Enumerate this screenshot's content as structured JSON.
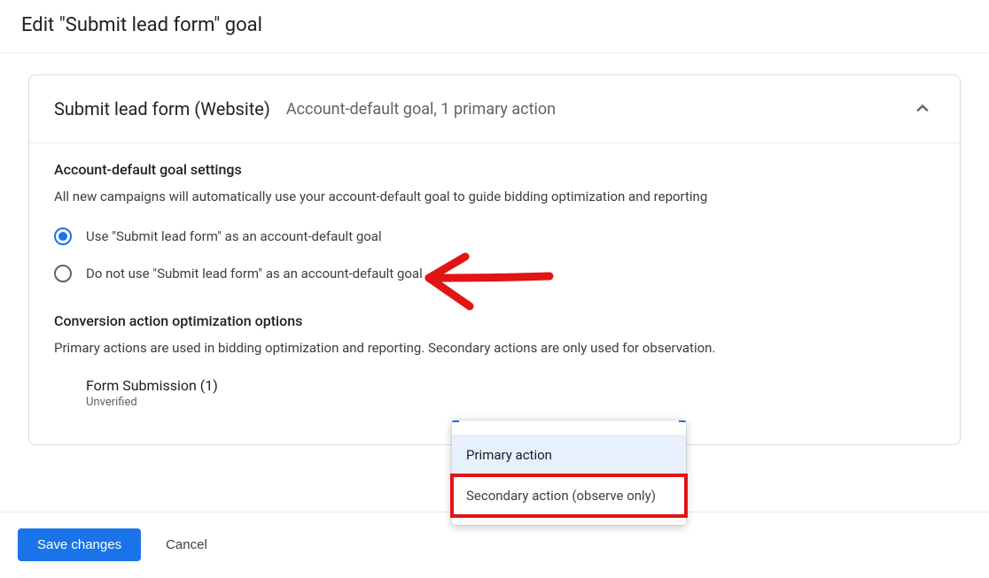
{
  "page": {
    "title": "Edit \"Submit lead form\" goal"
  },
  "card": {
    "title": "Submit lead form (Website)",
    "subtitle": "Account-default goal, 1 primary action",
    "expanded": true
  },
  "default_goal": {
    "heading": "Account-default goal settings",
    "description": "All new campaigns will automatically use your account-default goal to guide bidding optimization and reporting",
    "options": [
      {
        "label": "Use \"Submit lead form\" as an account-default goal",
        "selected": true
      },
      {
        "label": "Do not use \"Submit lead form\" as an account-default goal",
        "selected": false
      }
    ]
  },
  "optimization": {
    "heading": "Conversion action optimization options",
    "description": "Primary actions are used in bidding optimization and reporting. Secondary actions are only used for observation.",
    "action": {
      "name": "Form Submission (1)",
      "status": "Unverified"
    }
  },
  "dropdown": {
    "items": [
      {
        "label": "Primary action",
        "selected": true
      },
      {
        "label": "Secondary action (observe only)",
        "selected": false,
        "highlighted": true
      }
    ]
  },
  "footer": {
    "save": "Save changes",
    "cancel": "Cancel"
  }
}
